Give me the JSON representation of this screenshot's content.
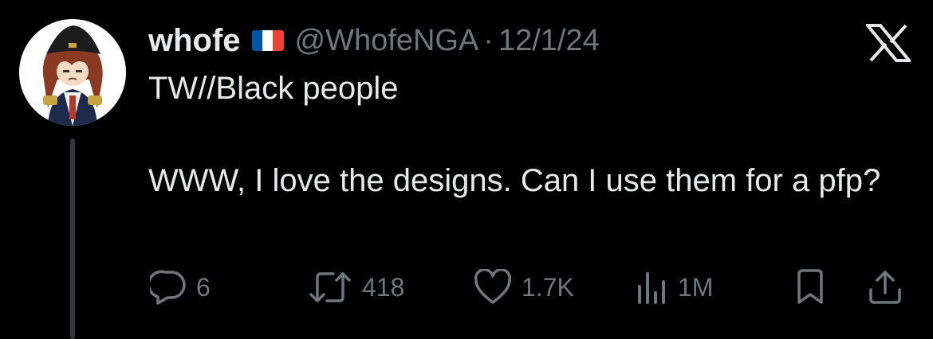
{
  "tweet": {
    "display_name": "whofe",
    "flag_icon": "france-flag-icon",
    "handle": "@WhofeNGA",
    "separator": "·",
    "date": "12/1/24",
    "text_lines": {
      "line1": "TW//Black people",
      "line2": "WWW, I love the designs. Can I use them for a pfp?"
    }
  },
  "actions": {
    "replies": "6",
    "reposts": "418",
    "likes": "1.7K",
    "views": "1M"
  },
  "colors": {
    "background": "#000000",
    "text_primary": "#e7e9ea",
    "text_secondary": "#71767b",
    "thread_line": "#333639",
    "flag_blue": "#0055a4",
    "flag_white": "#ffffff",
    "flag_red": "#ef4135"
  },
  "icons": {
    "brand": "x-logo-icon",
    "reply": "reply-icon",
    "repost": "repost-icon",
    "like": "heart-icon",
    "views": "views-bar-chart-icon",
    "bookmark": "bookmark-icon",
    "share": "share-icon"
  }
}
